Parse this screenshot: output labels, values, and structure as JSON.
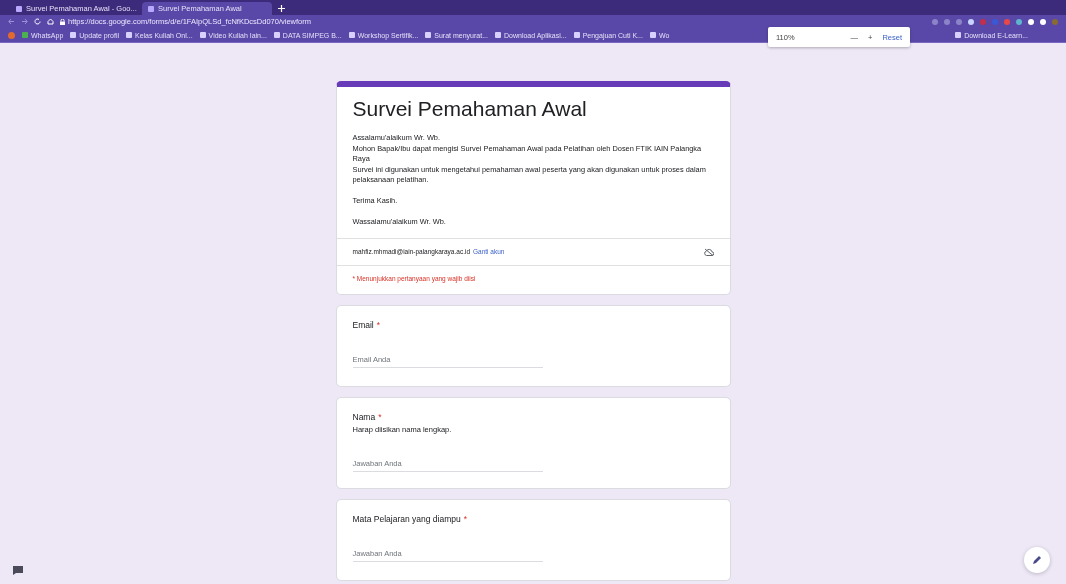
{
  "browser": {
    "tabs": [
      {
        "title": "Survei Pemahaman Awal - Goo...",
        "selected": false
      },
      {
        "title": "Survei Pemahaman Awal",
        "selected": true
      }
    ],
    "url": "https://docs.google.com/forms/d/e/1FAIpQLSd_fcNfKDcsDd070/viewform",
    "bookmarks": [
      "WhatsApp",
      "Update profil",
      "Kelas Kuliah Onl...",
      "Video Kuliah Iain...",
      "DATA SIMPEG B...",
      "Workshop Sertifik...",
      "Surat menyurat...",
      "Download Aplikasi...",
      "Pengajuan Cuti K...",
      "Wo"
    ],
    "zoom_popup": {
      "value": "110%",
      "minus": "—",
      "plus": "+",
      "reset": "Reset"
    },
    "bookmark_after_popup": "Download E-Learn..."
  },
  "form": {
    "title": "Survei Pemahaman Awal",
    "description": [
      "Assalamu'alaikum Wr. Wb.\nMohon Bapak/Ibu dapat mengisi Survei Pemahaman Awal pada Pelatihan oleh Dosen FTIK IAIN Palangka Raya\nSurvei ini digunakan untuk mengetahui pemahaman awal peserta yang akan digunakan untuk proses dalam pelaksanaan pelatihan.",
      "Terima Kasih.",
      "Wassalamu'alaikum Wr. Wb."
    ],
    "account": "mahfiz.mhmadi@iain-palangkaraya.ac.id",
    "switch_link": "Ganti akun",
    "required_note": "* Menunjukkan pertanyaan yang wajib diisi",
    "questions": [
      {
        "label": "Email",
        "required_mark": "*",
        "placeholder": "Email Anda"
      },
      {
        "label": "Nama",
        "required_mark": "*",
        "hint": "Harap diisikan nama lengkap.",
        "placeholder": "Jawaban Anda"
      },
      {
        "label": "Mata Pelajaran yang diampu",
        "required_mark": "*",
        "placeholder": "Jawaban Anda"
      }
    ]
  }
}
